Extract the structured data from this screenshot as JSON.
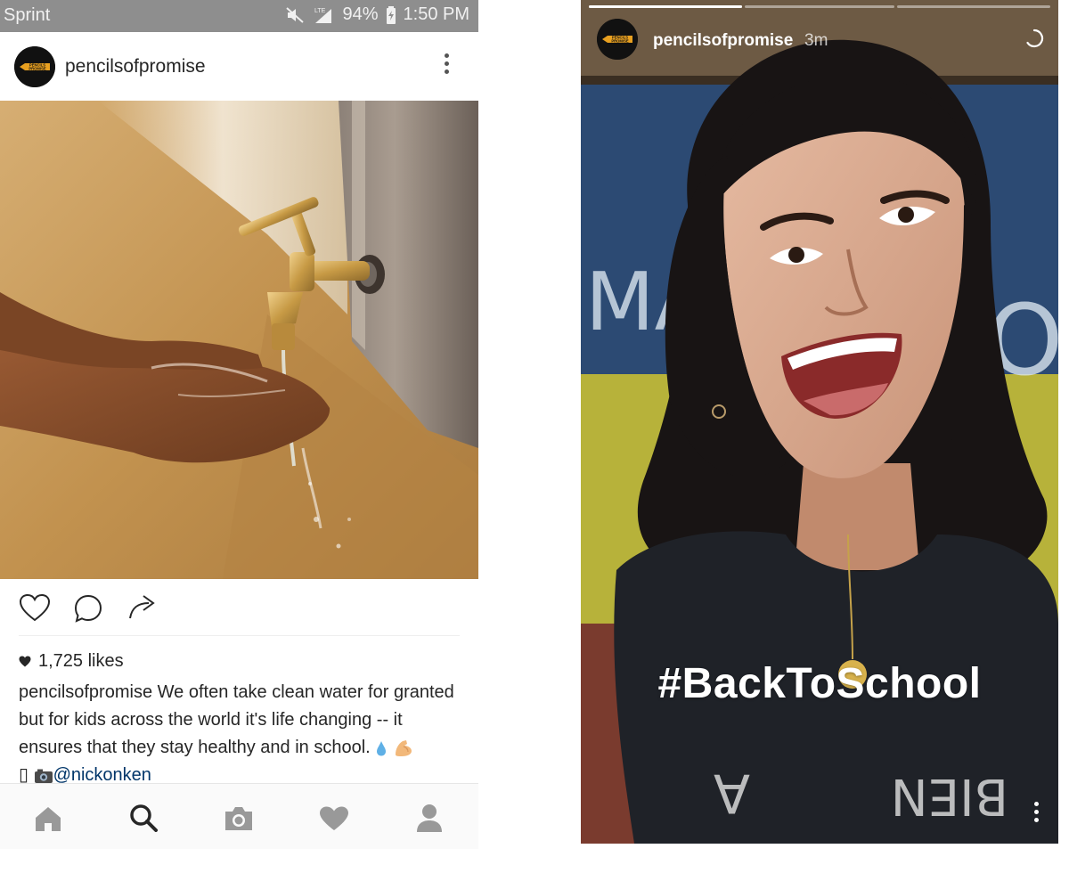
{
  "status_bar": {
    "carrier": "Sprint",
    "battery": "94%",
    "time": "1:50 PM",
    "network": "LTE",
    "icons": [
      "mute-icon",
      "signal-icon",
      "battery-charging-icon"
    ]
  },
  "post": {
    "username": "pencilsofpromise",
    "avatar_text": [
      "PENCILS",
      "PROMISE"
    ],
    "likes": "1,725 likes",
    "caption": {
      "username": "pencilsofpromise",
      "text": " We often take clean water for granted but for kids across the world it's life changing -- it ensures that they stay healthy and in school. ",
      "emoji_symbols": [
        "💧",
        "💪"
      ],
      "camera_prefix": "▯ ",
      "mention": "@nickonken"
    },
    "actions": [
      "heart-icon",
      "comment-icon",
      "share-icon"
    ]
  },
  "bottom_nav": {
    "items": [
      "home-icon",
      "search-icon",
      "camera-icon",
      "activity-heart-icon",
      "profile-icon"
    ],
    "active": "search-icon"
  },
  "story": {
    "username": "pencilsofpromise",
    "time": "3m",
    "hashtag": "#BackToSchool",
    "progress": [
      1.0,
      0.0,
      0.0
    ],
    "board_letters": [
      "MA",
      "O"
    ],
    "shirt_text": "A",
    "shirt_text_right": "BIEN",
    "colors": {
      "board": "#2c4a73",
      "wall_yellow": "#b7b23a",
      "shirt": "#1f2228",
      "hair": "#181414",
      "skin": "#dcae94"
    }
  },
  "colors": {
    "status_bar": "#8e8e8e",
    "text": "#262626",
    "mention": "#003569",
    "nav_bg": "#fafafa",
    "icon_grey": "#999999"
  }
}
